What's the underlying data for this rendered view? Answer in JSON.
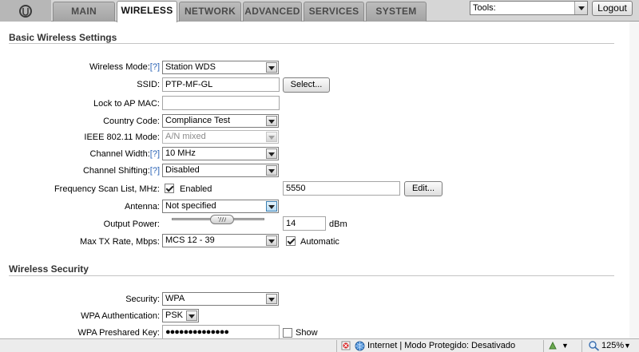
{
  "header": {
    "tabs": [
      {
        "label": "MAIN",
        "active": false
      },
      {
        "label": "WIRELESS",
        "active": true
      },
      {
        "label": "NETWORK",
        "active": false
      },
      {
        "label": "ADVANCED",
        "active": false
      },
      {
        "label": "SERVICES",
        "active": false
      },
      {
        "label": "SYSTEM",
        "active": false
      }
    ],
    "tools_label": "Tools:",
    "logout_label": "Logout"
  },
  "basic": {
    "title": "Basic Wireless Settings",
    "help_marker": "[?]",
    "wireless_mode": {
      "label": "Wireless Mode:",
      "value": "Station WDS"
    },
    "ssid": {
      "label": "SSID:",
      "value": "PTP-MF-GL",
      "button": "Select..."
    },
    "lock_ap": {
      "label": "Lock to AP MAC:",
      "value": ""
    },
    "country": {
      "label": "Country Code:",
      "value": "Compliance Test"
    },
    "ieee_mode": {
      "label": "IEEE 802.11 Mode:",
      "value": "A/N mixed"
    },
    "channel_width": {
      "label": "Channel Width:",
      "value": "10 MHz"
    },
    "channel_shift": {
      "label": "Channel Shifting:",
      "value": "Disabled"
    },
    "freq_scan": {
      "label": "Frequency Scan List, MHz:",
      "checkbox_label": "Enabled",
      "checked": true,
      "value": "5550",
      "button": "Edit..."
    },
    "antenna": {
      "label": "Antenna:",
      "value": "Not specified"
    },
    "output_power": {
      "label": "Output Power:",
      "value": "14",
      "unit": "dBm"
    },
    "max_tx": {
      "label": "Max TX Rate, Mbps:",
      "value": "MCS 12 - 39",
      "checkbox_label": "Automatic",
      "checked": true
    }
  },
  "security": {
    "title": "Wireless Security",
    "security": {
      "label": "Security:",
      "value": "WPA"
    },
    "wpa_auth": {
      "label": "WPA Authentication:",
      "value": "PSK"
    },
    "wpa_key": {
      "label": "WPA Preshared Key:",
      "value": "●●●●●●●●●●●●●●",
      "show_label": "Show"
    }
  },
  "statusbar": {
    "zone": "Internet | Modo Protegido: Desativado",
    "zoom": "125%"
  },
  "colors": {
    "help": "#2b63b5",
    "tab_bg": "#a3a3a3",
    "rule": "#c4c4c4"
  }
}
